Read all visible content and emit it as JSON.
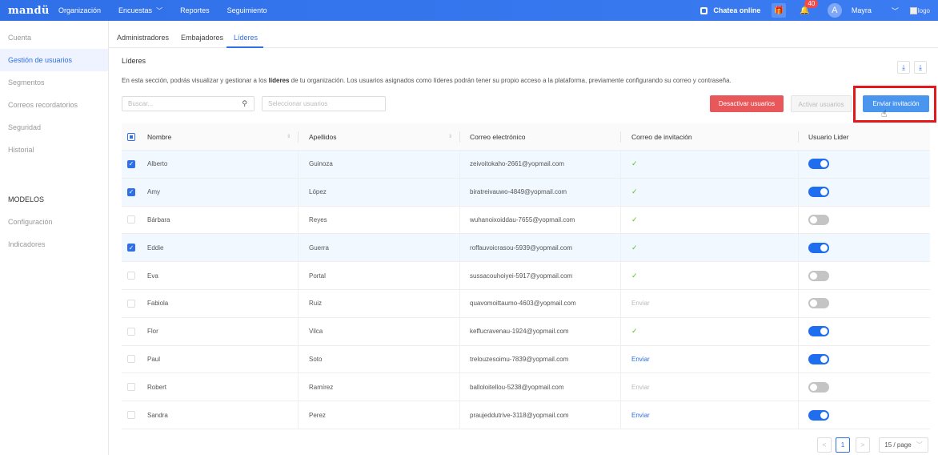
{
  "nav": {
    "brand": "mandü",
    "items": [
      "Organización",
      "Encuestas",
      "Reportes",
      "Seguimiento"
    ],
    "chat_label": "Chatea online",
    "notifications_count": "40",
    "avatar_initial": "A",
    "user_name": "Mayra",
    "logo_alt": "logo"
  },
  "sidebar": {
    "items": [
      "Cuenta",
      "Gestión de usuarios",
      "Segmentos",
      "Correos recordatorios",
      "Seguridad",
      "Historial"
    ],
    "section": "MODELOS",
    "section_items": [
      "Configuración",
      "Indicadores"
    ]
  },
  "tabs": [
    "Administradores",
    "Embajadores",
    "Líderes"
  ],
  "page": {
    "title": "Líderes",
    "desc_before": "En esta sección, podrás visualizar y gestionar a los ",
    "desc_bold": "líderes",
    "desc_after": " de tu organización. Los usuarios asignados como líderes podrán tener su propio acceso a la plataforma, previamente configurando su correo y contraseña."
  },
  "toolbar": {
    "search_placeholder": "Buscar...",
    "select_placeholder": "Seleccionar usuarios",
    "deactivate_label": "Desactivar usuarios",
    "activate_label": "Activar usuarios",
    "invite_label": "Enviar invitación"
  },
  "table": {
    "headers": [
      "Nombre",
      "Apellidos",
      "Correo electrónico",
      "Correo de invitación",
      "Usuario Lider"
    ],
    "rows": [
      {
        "selected": true,
        "nombre": "Alberto",
        "apellidos": "Guinoza",
        "correo": "zeivoitokaho-2661@yopmail.com",
        "invitacion": "sent",
        "lider": true
      },
      {
        "selected": true,
        "nombre": "Amy",
        "apellidos": "López",
        "correo": "biratreivauwo-4849@yopmail.com",
        "invitacion": "sent",
        "lider": true
      },
      {
        "selected": false,
        "nombre": "Bárbara",
        "apellidos": "Reyes",
        "correo": "wuhanoixoiddau-7655@yopmail.com",
        "invitacion": "sent",
        "lider": false
      },
      {
        "selected": true,
        "nombre": "Eddie",
        "apellidos": "Guerra",
        "correo": "roffauvoicrasou-5939@yopmail.com",
        "invitacion": "sent",
        "lider": true
      },
      {
        "selected": false,
        "nombre": "Eva",
        "apellidos": "Portal",
        "correo": "sussacouhoiyei-5917@yopmail.com",
        "invitacion": "sent",
        "lider": false
      },
      {
        "selected": false,
        "nombre": "Fabiola",
        "apellidos": "Ruiz",
        "correo": "quavomoittaumo-4603@yopmail.com",
        "invitacion": "disabled",
        "lider": false
      },
      {
        "selected": false,
        "nombre": "Flor",
        "apellidos": "Vilca",
        "correo": "keffucravenau-1924@yopmail.com",
        "invitacion": "sent",
        "lider": true
      },
      {
        "selected": false,
        "nombre": "Paul",
        "apellidos": "Soto",
        "correo": "trelouzesoimu-7839@yopmail.com",
        "invitacion": "send",
        "lider": true
      },
      {
        "selected": false,
        "nombre": "Robert",
        "apellidos": "Ramírez",
        "correo": "balloloitellou-5238@yopmail.com",
        "invitacion": "disabled",
        "lider": false
      },
      {
        "selected": false,
        "nombre": "Sandra",
        "apellidos": "Perez",
        "correo": "praujeddutrive-3118@yopmail.com",
        "invitacion": "send",
        "lider": true
      }
    ],
    "send_label": "Enviar",
    "sent_mark": "✓"
  },
  "pagination": {
    "prev": "<",
    "current": "1",
    "next": ">",
    "page_size": "15 / page"
  },
  "colors": {
    "primary": "#2f6fe8",
    "danger": "#e8575a",
    "success": "#52c41a",
    "annotation": "#e3181c"
  }
}
